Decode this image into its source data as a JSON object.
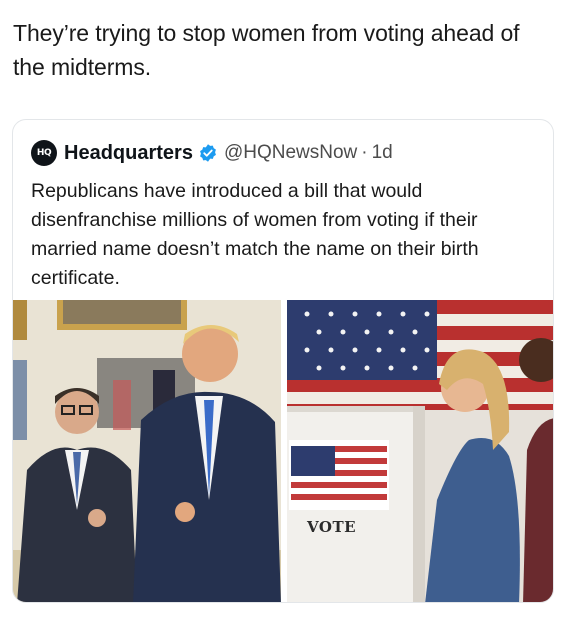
{
  "post": {
    "text": "They’re trying to stop women from voting ahead of the midterms."
  },
  "quoted_tweet": {
    "avatar_text": "HQ",
    "display_name": "Headquarters",
    "verified_icon": "verified-badge-icon",
    "handle": "@HQNewsNow",
    "separator": "·",
    "time": "1d",
    "body": "Republicans have introduced a bill that would disenfranchise millions of women from voting if their married name doesn’t match the name on their birth certificate.",
    "media": {
      "left_image": "photo-two-men-in-suits-thumbs-up",
      "right_image": "photo-woman-at-voting-booth",
      "booth_sign_text": "VOTE"
    }
  },
  "colors": {
    "verified_blue": "#1d9bf0",
    "text_primary": "#0f1419",
    "text_secondary": "#4c4c4c",
    "card_border": "#e3e6e9"
  }
}
